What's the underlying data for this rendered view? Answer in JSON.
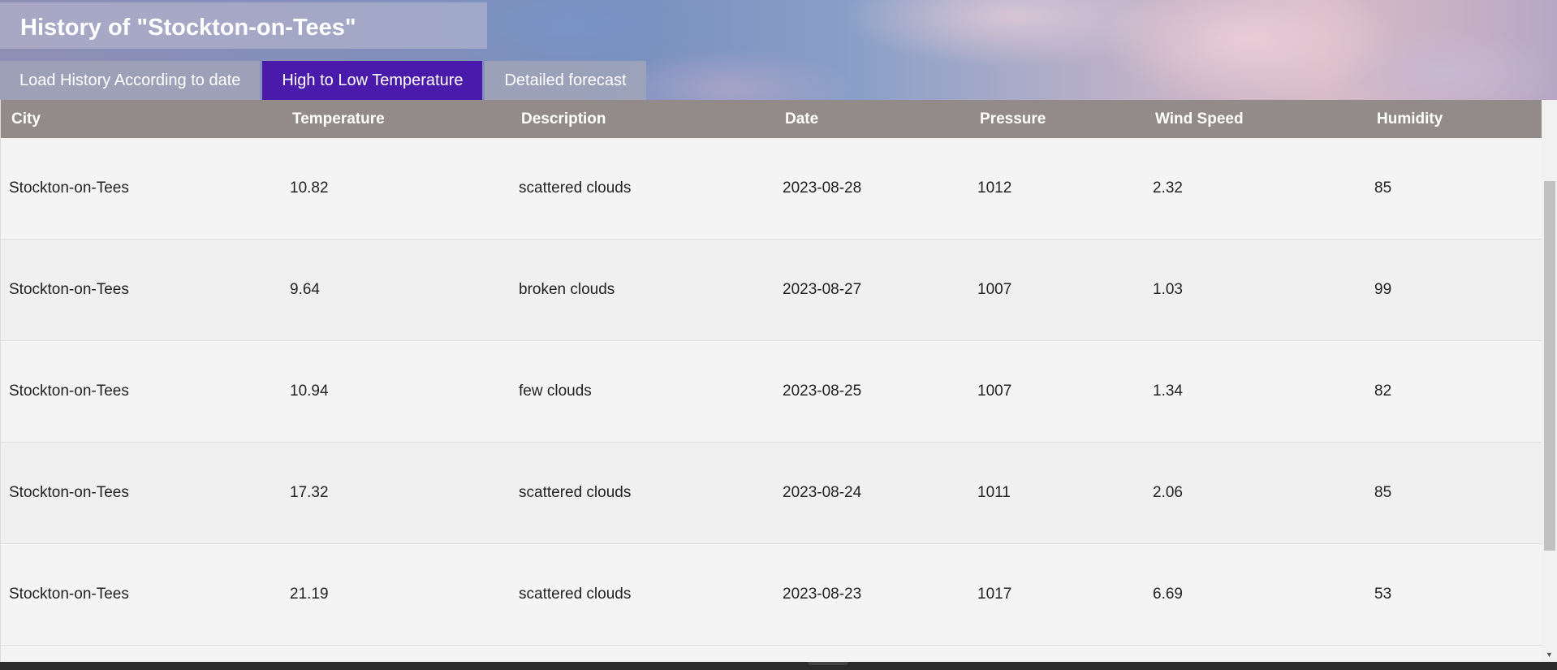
{
  "header": {
    "title": "History of \"Stockton-on-Tees\""
  },
  "tabs": [
    {
      "label": "Load History According to date",
      "active": false
    },
    {
      "label": "High to Low Temperature",
      "active": true
    },
    {
      "label": "Detailed forecast",
      "active": false
    }
  ],
  "table": {
    "columns": [
      "City",
      "Temperature",
      "Description",
      "Date",
      "Pressure",
      "Wind Speed",
      "Humidity"
    ],
    "rows": [
      {
        "city": "Stockton-on-Tees",
        "temperature": "10.82",
        "description": "scattered clouds",
        "date": "2023-08-28",
        "pressure": "1012",
        "wind_speed": "2.32",
        "humidity": "85"
      },
      {
        "city": "Stockton-on-Tees",
        "temperature": "9.64",
        "description": "broken clouds",
        "date": "2023-08-27",
        "pressure": "1007",
        "wind_speed": "1.03",
        "humidity": "99"
      },
      {
        "city": "Stockton-on-Tees",
        "temperature": "10.94",
        "description": "few clouds",
        "date": "2023-08-25",
        "pressure": "1007",
        "wind_speed": "1.34",
        "humidity": "82"
      },
      {
        "city": "Stockton-on-Tees",
        "temperature": "17.32",
        "description": "scattered clouds",
        "date": "2023-08-24",
        "pressure": "1011",
        "wind_speed": "2.06",
        "humidity": "85"
      },
      {
        "city": "Stockton-on-Tees",
        "temperature": "21.19",
        "description": "scattered clouds",
        "date": "2023-08-23",
        "pressure": "1017",
        "wind_speed": "6.69",
        "humidity": "53"
      }
    ]
  },
  "colors": {
    "active_tab": "#4a1aaa",
    "header_row": "#928b89"
  }
}
